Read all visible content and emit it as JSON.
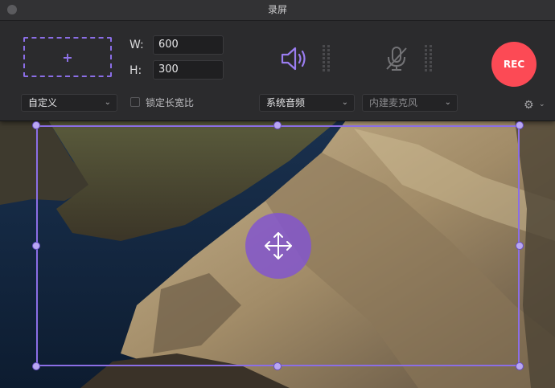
{
  "window": {
    "title": "录屏"
  },
  "area": {
    "add_label": "+"
  },
  "dimensions": {
    "width_label": "W:",
    "width_value": "600",
    "height_label": "H:",
    "height_value": "300"
  },
  "preset": {
    "selected": "自定义"
  },
  "aspect_lock": {
    "label": "锁定长宽比",
    "checked": false
  },
  "audio": {
    "system_label": "系统音频",
    "mic_label": "内建麦克风"
  },
  "record": {
    "label": "REC"
  },
  "colors": {
    "accent": "#8b6ee6",
    "record": "#fc4a55",
    "panel": "#2b2b2d"
  }
}
